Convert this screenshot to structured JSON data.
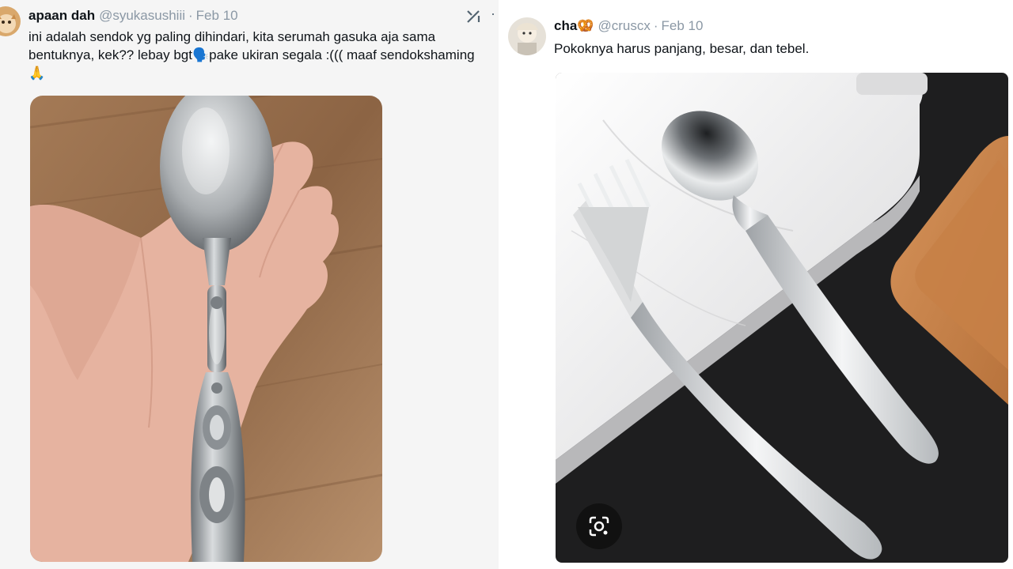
{
  "tweet_left": {
    "display_name": "apaan dah",
    "handle": "@syukasushiii",
    "separator": "·",
    "date": "Feb 10",
    "text_line1": "ini adalah sendok yg paling dihindari, kita serumah gasuka aja sama",
    "text_line2": "bentuknya, kek?? lebay bgt🗣️pake ukiran segala :((( maaf sendokshaming",
    "text_line3": "🙏",
    "more_icon": "more-horizontal-icon",
    "grok_icon": "grok-icon"
  },
  "tweet_right": {
    "display_name": "cha🥨",
    "handle": "@cruscx",
    "separator": "·",
    "date": "Feb 10",
    "text": "Pokoknya harus panjang, besar, dan tebel.",
    "lens_icon": "google-lens-icon"
  },
  "colors": {
    "text_primary": "#0f1419",
    "text_secondary": "#8b98a5",
    "panel_left_bg": "#f5f5f5"
  }
}
